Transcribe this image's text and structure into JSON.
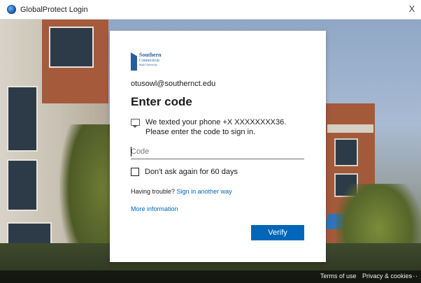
{
  "window": {
    "title": "GlobalProtect Login",
    "close_glyph": "X"
  },
  "logo": {
    "line1": "Southern",
    "line2": "Connecticut",
    "line3": "State University"
  },
  "signin": {
    "email": "otusowl@southernct.edu",
    "heading": "Enter code",
    "message": "We texted your phone +X XXXXXXXX36. Please enter the code to sign in.",
    "code_placeholder": "Code",
    "code_value": "",
    "remember_label": "Don't ask again for 60 days",
    "remember_checked": false,
    "trouble_prefix": "Having trouble?",
    "trouble_link": "Sign in another way",
    "more_info": "More information",
    "verify_label": "Verify"
  },
  "footer": {
    "terms": "Terms of use",
    "privacy": "Privacy & cookies",
    "more": "..."
  },
  "colors": {
    "accent": "#0067b8",
    "logo_blue": "#2a5f9e"
  },
  "icons": {
    "app": "globalprotect-globe-icon",
    "message": "speech-bubble-icon",
    "close": "close-icon"
  }
}
